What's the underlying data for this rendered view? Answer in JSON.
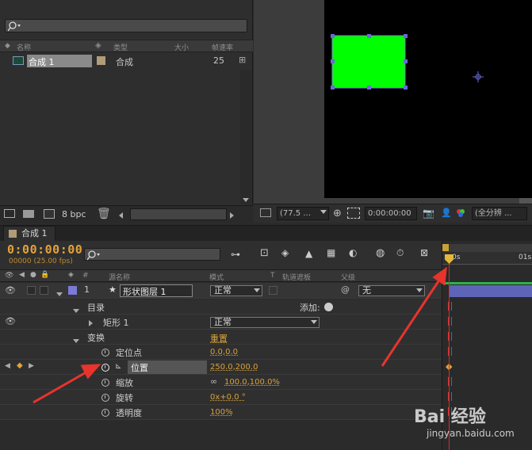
{
  "project": {
    "columns": [
      "名称",
      "类型",
      "大小",
      "帧速率"
    ],
    "items": [
      {
        "name": "合成 1",
        "type": "合成",
        "size": "",
        "fps": "25"
      }
    ],
    "bpc": "8 bpc"
  },
  "viewer": {
    "zoom": "(77.5 ...",
    "timecode": "0:00:00:00",
    "resolution": "(全分辨 ..."
  },
  "timeline": {
    "tab_label": "合成 1",
    "timecode": "0:00:00:00",
    "frames_fps": "00000 (25.00 fps)",
    "ruler_labels": [
      "0s",
      "01s"
    ],
    "column_headers": {
      "hash": "#",
      "source_name": "源名称",
      "mode": "模式",
      "t": "T",
      "trkmat": "轨道遮板",
      "parent": "父级"
    },
    "layer": {
      "index": "1",
      "name": "形状图层 1",
      "mode": "正常",
      "parent": "无"
    },
    "contents": {
      "label": "目录",
      "add_label": "添加:"
    },
    "rect": {
      "label": "矩形 1",
      "mode": "正常"
    },
    "transform": {
      "label": "变换",
      "reset": "重置"
    },
    "properties": [
      {
        "label": "定位点",
        "value": "0.0,0.0"
      },
      {
        "label": "位置",
        "value": "250.0,200.0"
      },
      {
        "label": "缩放",
        "value": "100.0,100.0%"
      },
      {
        "label": "旋转",
        "value": "0x+0.0 °"
      },
      {
        "label": "透明度",
        "value": "100%"
      }
    ]
  },
  "watermark": {
    "brand": "Bai 经验",
    "url": "jingyan.baidu.com"
  },
  "colors": {
    "accent_orange": "#e3a23a",
    "shape_green": "#00ff00",
    "layer_label_blue": "#7a7ad8",
    "playhead_red": "#d62b2b",
    "annotation_arrow": "#e8342d"
  }
}
